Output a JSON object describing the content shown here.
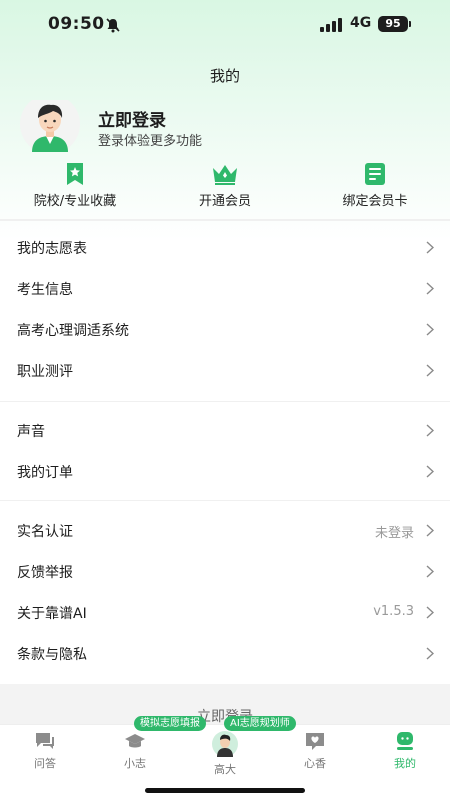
{
  "status_bar": {
    "time": "09:50",
    "network": "4G",
    "battery": "95"
  },
  "header": {
    "title": "我的"
  },
  "profile": {
    "login_title": "立即登录",
    "login_subtitle": "登录体验更多功能"
  },
  "quick_actions": [
    {
      "label": "院校/专业收藏",
      "icon": "bookmark-star-icon"
    },
    {
      "label": "开通会员",
      "icon": "crown-icon"
    },
    {
      "label": "绑定会员卡",
      "icon": "card-icon"
    }
  ],
  "menu_group_1": [
    {
      "label": "我的志愿表"
    },
    {
      "label": "考生信息"
    },
    {
      "label": "高考心理调适系统"
    },
    {
      "label": "职业测评"
    }
  ],
  "menu_group_2": [
    {
      "label": "声音"
    },
    {
      "label": "我的订单"
    }
  ],
  "menu_group_3": [
    {
      "label": "实名认证",
      "value": "未登录"
    },
    {
      "label": "反馈举报",
      "value": ""
    },
    {
      "label": "关于靠谱AI",
      "value": "v1.5.3"
    },
    {
      "label": "条款与隐私",
      "value": ""
    }
  ],
  "ghost_login": "立即登录",
  "tab_pills": [
    "模拟志愿填报",
    "AI志愿规划师"
  ],
  "tabs": [
    {
      "label": "问答",
      "icon": "chat-icon"
    },
    {
      "label": "小志",
      "icon": "graduation-cap-icon"
    },
    {
      "label": "高大",
      "icon": "avatar-icon"
    },
    {
      "label": "心香",
      "icon": "heart-message-icon"
    },
    {
      "label": "我的",
      "icon": "user-icon"
    }
  ],
  "colors": {
    "accent": "#2fb86b",
    "header_bg": "#d9f7e3"
  }
}
